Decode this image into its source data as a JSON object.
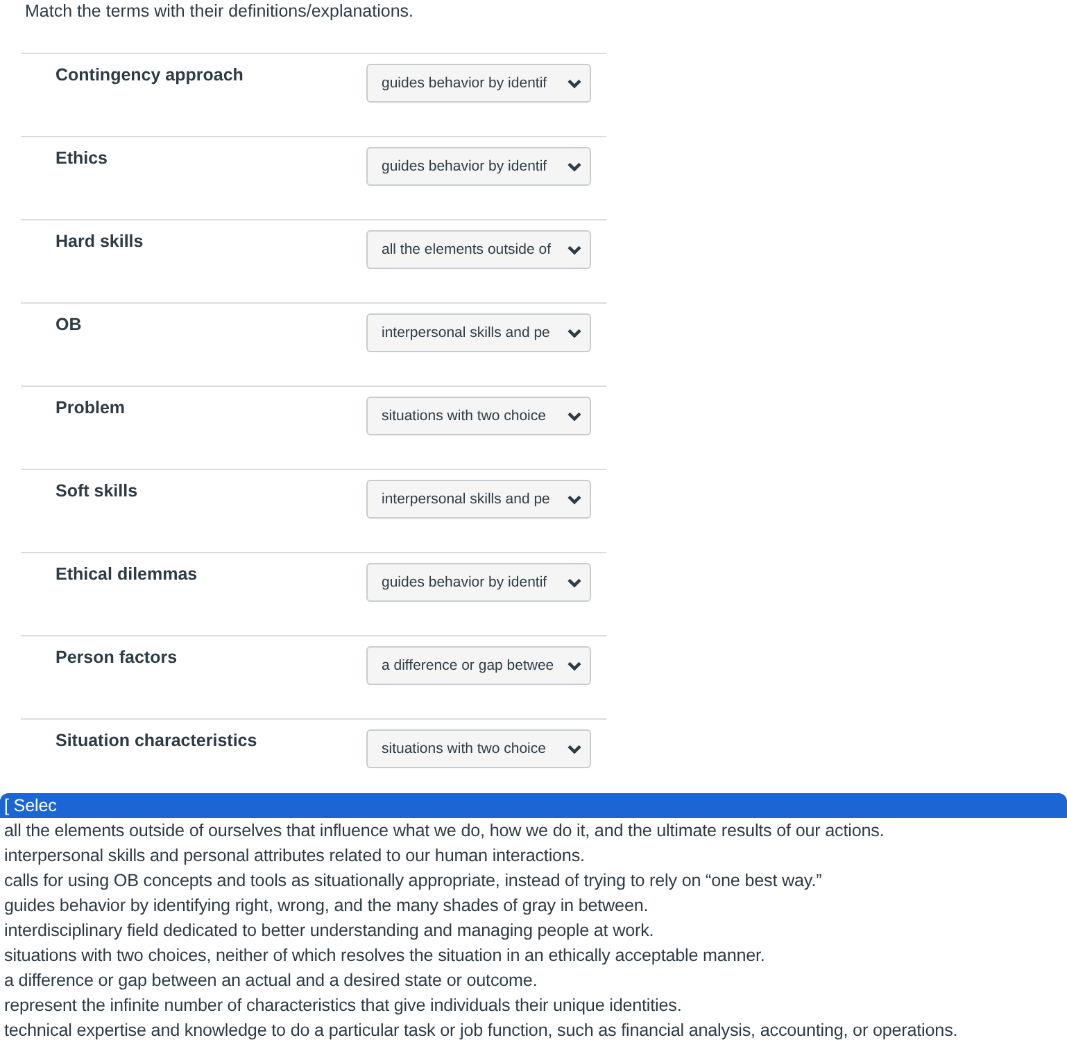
{
  "instruction": "Match the terms with their definitions/explanations.",
  "rows": [
    {
      "term": "Contingency approach",
      "answer": "guides behavior by identif"
    },
    {
      "term": "Ethics",
      "answer": "guides behavior by identif"
    },
    {
      "term": "Hard skills",
      "answer": "all the elements outside of"
    },
    {
      "term": "OB",
      "answer": "interpersonal skills and pe"
    },
    {
      "term": "Problem",
      "answer": "situations with two choice"
    },
    {
      "term": "Soft skills",
      "answer": "interpersonal skills and pe"
    },
    {
      "term": "Ethical dilemmas",
      "answer": "guides behavior by identif"
    },
    {
      "term": "Person factors",
      "answer": "a difference or gap betwee"
    },
    {
      "term": "Situation characteristics",
      "answer": "situations with two choice"
    }
  ],
  "dropdown_options": [
    {
      "label": "[ Selec",
      "selected": true
    },
    {
      "label": "all the elements outside of ourselves that influence what we do, how we do it, and the ultimate results of our actions.",
      "selected": false
    },
    {
      "label": "interpersonal skills and personal attributes related to our human interactions.",
      "selected": false
    },
    {
      "label": "calls for using OB concepts and tools as situationally appropriate, instead of trying to rely on “one best way.”",
      "selected": false
    },
    {
      "label": "guides behavior by identifying right, wrong, and the many shades of gray in between.",
      "selected": false
    },
    {
      "label": "interdisciplinary field dedicated to better understanding and managing people at work.",
      "selected": false
    },
    {
      "label": "situations with two choices, neither of which resolves the situation in an ethically acceptable manner.",
      "selected": false
    },
    {
      "label": "a difference or gap between an actual and a desired state or outcome.",
      "selected": false
    },
    {
      "label": "represent the infinite number of characteristics that give individuals their unique identities.",
      "selected": false
    },
    {
      "label": "technical expertise and knowledge to do a particular task or job function, such as financial analysis, accounting, or operations.",
      "selected": false
    }
  ]
}
